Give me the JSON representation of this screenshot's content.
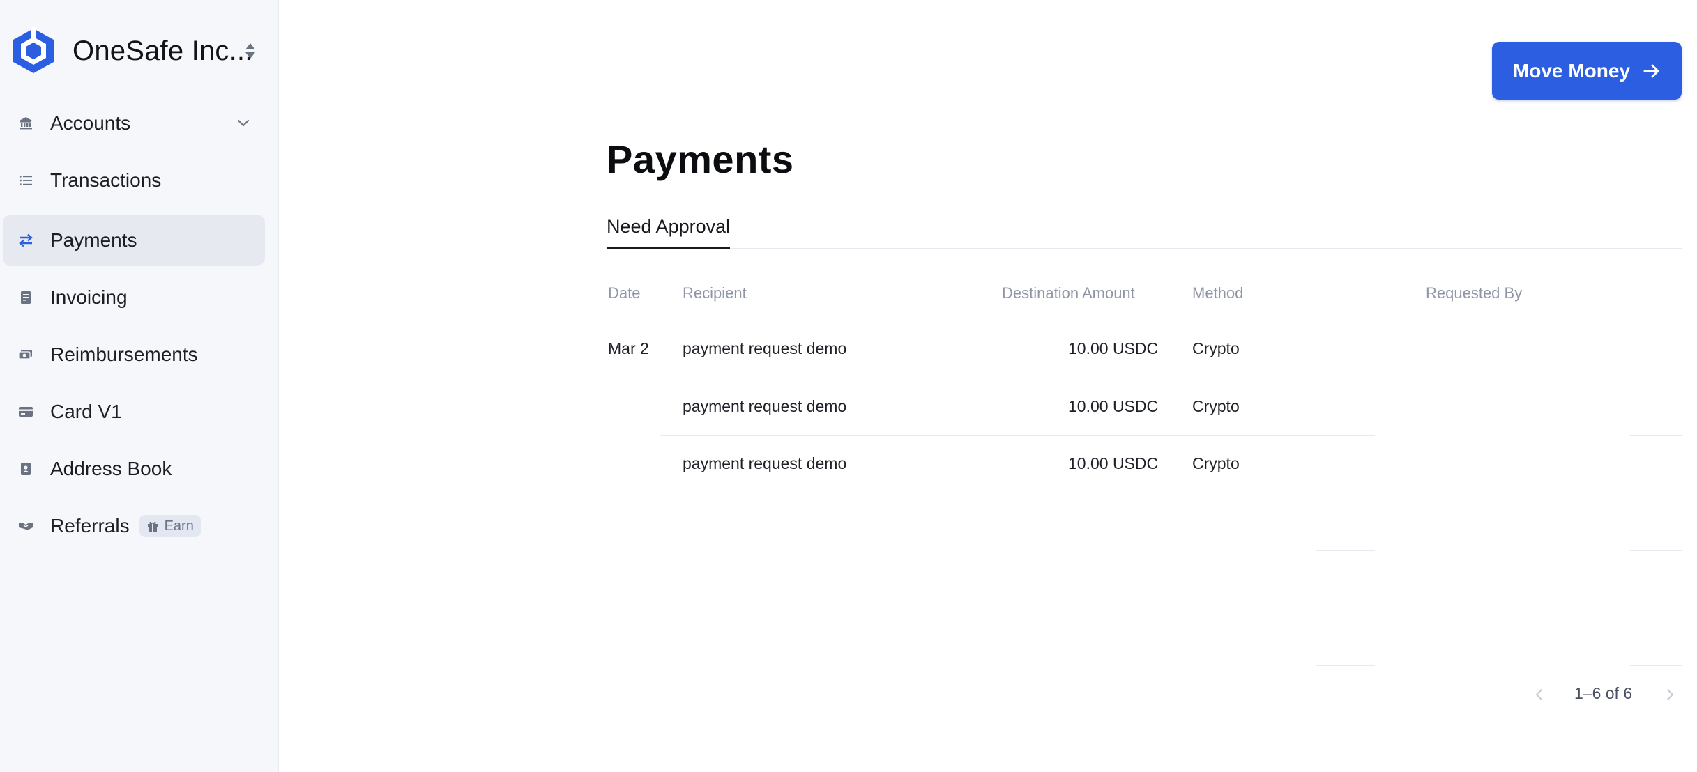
{
  "brand": {
    "name": "OneSafe Inc..."
  },
  "sidebar": {
    "items": [
      {
        "label": "Accounts",
        "icon": "bank-icon"
      },
      {
        "label": "Transactions",
        "icon": "list-icon"
      },
      {
        "label": "Payments",
        "icon": "transfer-arrows-icon",
        "active": true
      },
      {
        "label": "Invoicing",
        "icon": "invoice-icon"
      },
      {
        "label": "Reimbursements",
        "icon": "cash-icon"
      },
      {
        "label": "Card V1",
        "icon": "card-icon"
      },
      {
        "label": "Address Book",
        "icon": "contact-book-icon"
      },
      {
        "label": "Referrals",
        "icon": "handshake-icon",
        "badge": "Earn"
      }
    ]
  },
  "header": {
    "move_money_label": "Move Money"
  },
  "page": {
    "title": "Payments"
  },
  "tabs": [
    {
      "label": "Need Approval",
      "active": true
    }
  ],
  "table": {
    "columns": [
      "Date",
      "Recipient",
      "Destination Amount",
      "Method",
      "Requested By"
    ],
    "rows": [
      {
        "date": "Mar 2",
        "recipient": "payment request demo",
        "amount": "10.00 USDC",
        "method": "Crypto",
        "requested_by": ""
      },
      {
        "date": "",
        "recipient": "payment request demo",
        "amount": "10.00 USDC",
        "method": "Crypto",
        "requested_by": ""
      },
      {
        "date": "",
        "recipient": "payment request demo",
        "amount": "10.00 USDC",
        "method": "Crypto",
        "requested_by": ""
      }
    ]
  },
  "pagination": {
    "text": "1–6 of 6"
  },
  "colors": {
    "accent": "#2b5ee0",
    "sidebar_bg": "#f5f7fb",
    "active_item_bg": "#e6e9ef",
    "muted_text": "#8f97a6"
  }
}
